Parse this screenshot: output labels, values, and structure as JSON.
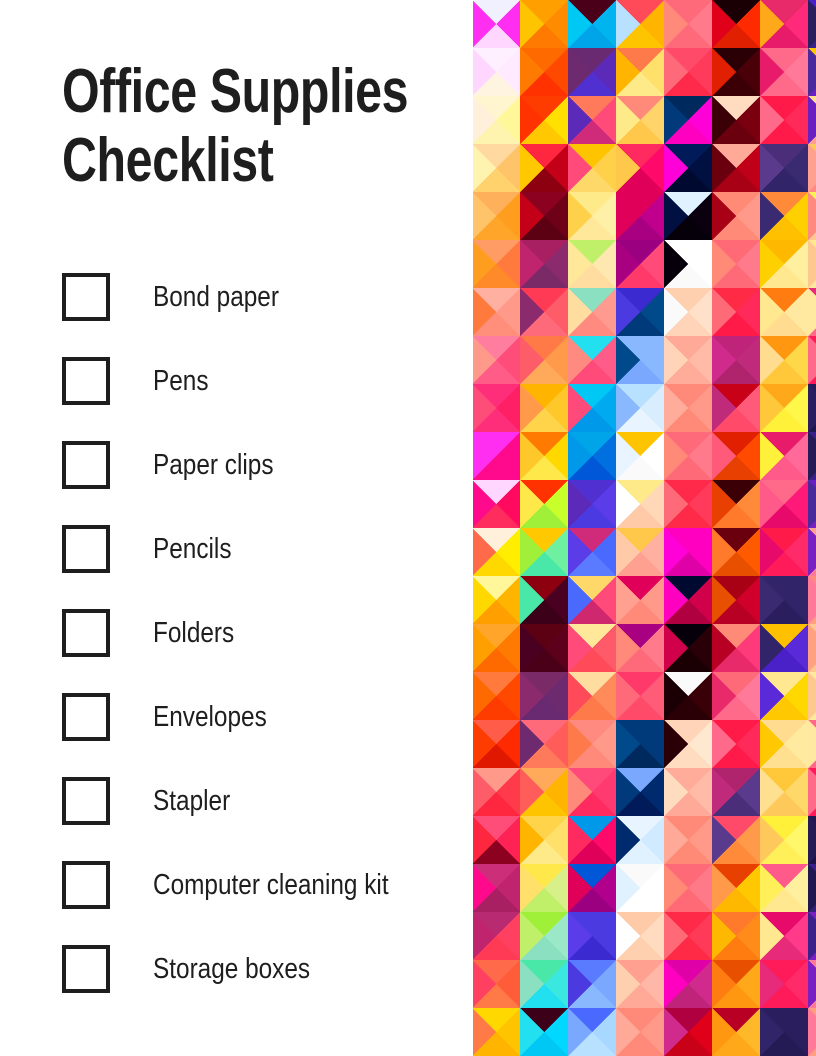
{
  "document": {
    "title_line_1": "Office Supplies",
    "title_line_2": "Checklist"
  },
  "checklist": {
    "items": [
      {
        "label": "Bond paper",
        "checked": false
      },
      {
        "label": "Pens",
        "checked": false
      },
      {
        "label": "Paper clips",
        "checked": false
      },
      {
        "label": "Pencils",
        "checked": false
      },
      {
        "label": "Folders",
        "checked": false
      },
      {
        "label": "Envelopes",
        "checked": false
      },
      {
        "label": "Stapler",
        "checked": false
      },
      {
        "label": "Computer cleaning kit",
        "checked": false
      },
      {
        "label": "Storage boxes",
        "checked": false
      }
    ]
  },
  "theme": {
    "text_color": "#1e1e1e",
    "page_background": "#ffffff",
    "checkbox_border": "#1e1e1e"
  },
  "decoration": {
    "name": "geometric-diamond-pattern",
    "cell": 48,
    "origin_x": -1,
    "origin_y": 0,
    "columns": 8,
    "rows": 22,
    "note": "Each grid cell is a 48x48 square split by both diagonals into 4 triangles: top, right, bottom, left.",
    "grid": [
      [
        "#f0f0ff",
        "#ff2ef0",
        "#ffd6ff",
        "#ff2ef0"
      ],
      [
        "#fff0ff",
        "#ffeaff",
        "#fff4e0",
        "#ffd6ff"
      ],
      [
        "#fff6d0",
        "#fff79a",
        "#fff3b0",
        "#fff0dc"
      ],
      [
        "#ffd9a0",
        "#ffc46a",
        "#ffd26e",
        "#fff3b0"
      ],
      [
        "#ffb05a",
        "#ff9d1e",
        "#ffa52a",
        "#ffc46a"
      ],
      [
        "#ff9c66",
        "#ff7a3c",
        "#ff8a2a",
        "#ff9d1e"
      ],
      [
        "#ffb0a0",
        "#ff9a8a",
        "#ff8f7a",
        "#ff7a3c"
      ],
      [
        "#ff7d9e",
        "#ff4d7a",
        "#ff5c88",
        "#ff9a8a"
      ],
      [
        "#ff2e7a",
        "#ff1f66",
        "#ff2e7a",
        "#ff4d7a"
      ],
      [
        "#ff2ef0",
        "#ff0a8c",
        "#ff0a8c",
        "#ff2ef0"
      ],
      [
        "#ffd6ff",
        "#ff0a5e",
        "#ff2d5e",
        "#ff0a8c"
      ],
      [
        "#fff0dc",
        "#ffee00",
        "#ffd800",
        "#ff6a4a"
      ],
      [
        "#fff79a",
        "#ffb400",
        "#ffa000",
        "#ffd800"
      ],
      [
        "#ffa52a",
        "#ff7a00",
        "#ff6a00",
        "#ffa000"
      ],
      [
        "#ff7a3c",
        "#ff4800",
        "#ff3c00",
        "#ff6a00"
      ],
      [
        "#ff5c4a",
        "#ff2a00",
        "#e01800",
        "#ff3c00"
      ],
      [
        "#ff9a8a",
        "#ff3a4a",
        "#ff2640",
        "#ff5c6a"
      ],
      [
        "#ff4d7a",
        "#ff2355",
        "#8c0020",
        "#ff2640"
      ],
      [
        "#cc2e7a",
        "#c0246e",
        "#a81f62",
        "#ff0a8c"
      ],
      [
        "#b82a72",
        "#ff4060",
        "#ff3a55",
        "#c0246e"
      ],
      [
        "#ff6a4a",
        "#ff5c3a",
        "#ff7a46",
        "#ff4060"
      ],
      [
        "#ffd800",
        "#ffc400",
        "#ffb400",
        "#ff7a46"
      ],
      [
        "#ffa000",
        "#ff8c00",
        "#ff7a00",
        "#ffc400"
      ],
      [
        "#ff6a00",
        "#ff4800",
        "#ff3200",
        "#ff7a00"
      ],
      [
        "#ff3c00",
        "#ffe000",
        "#ffc800",
        "#ff3200"
      ],
      [
        "#ff2640",
        "#c40018",
        "#8c0010",
        "#ffc800"
      ],
      [
        "#8c0020",
        "#6e0018",
        "#5c0014",
        "#c40018"
      ],
      [
        "#a81f62",
        "#8c2a6e",
        "#7a2a66",
        "#c0246e"
      ],
      [
        "#ff3a55",
        "#ff5c6a",
        "#ff6a7a",
        "#8c2a6e"
      ],
      [
        "#ff7a46",
        "#ff9a4a",
        "#ffaa5a",
        "#ff5c6a"
      ],
      [
        "#ffb400",
        "#ffc82a",
        "#ffd44a",
        "#ff9a4a"
      ],
      [
        "#ff7a00",
        "#ffd800",
        "#ffe84a",
        "#ffc82a"
      ],
      [
        "#ff3200",
        "#c8ff2a",
        "#a0f03a",
        "#ffe84a"
      ],
      [
        "#ffc800",
        "#6ef0a0",
        "#4ae8a8",
        "#a0f03a"
      ],
      [
        "#8c0010",
        "#4a0020",
        "#3c0018",
        "#4ae8a8"
      ],
      [
        "#5c0014",
        "#5c001c",
        "#4a0018",
        "#4a0020"
      ],
      [
        "#7a2a66",
        "#6e2a6e",
        "#6a2a72",
        "#8c2a6e"
      ],
      [
        "#ff6a7a",
        "#ff5c5a",
        "#ff7a5a",
        "#6e2a6e"
      ],
      [
        "#ffaa5a",
        "#ffb400",
        "#ffc400",
        "#ff5c5a"
      ],
      [
        "#ffd44a",
        "#ffe06a",
        "#ffea8a",
        "#ffb400"
      ],
      [
        "#ffe84a",
        "#d8f08a",
        "#c0f06a",
        "#ffe06a"
      ],
      [
        "#a0f03a",
        "#9ae8c8",
        "#8ae0c0",
        "#c0f06a"
      ],
      [
        "#4ae8a8",
        "#3ae8e0",
        "#22e0f0",
        "#8ae0c0"
      ],
      [
        "#3c0018",
        "#00d8ff",
        "#00c8f5",
        "#22e0f0"
      ],
      [
        "#4a0018",
        "#00b4f0",
        "#00a4e8",
        "#00c8f5"
      ],
      [
        "#6a2a72",
        "#5c2ab8",
        "#5030d0",
        "#6e2a6e"
      ],
      [
        "#ff7a5a",
        "#ff4a7a",
        "#d02a7a",
        "#5c2ab8"
      ],
      [
        "#ffc400",
        "#ffd04a",
        "#ffd86a",
        "#ff4a7a"
      ],
      [
        "#ffea8a",
        "#fff0a8",
        "#ffe89a",
        "#ffd04a"
      ],
      [
        "#c0f06a",
        "#ffe8b0",
        "#ffdca0",
        "#ffe89a"
      ],
      [
        "#8ae0c0",
        "#ff9a90",
        "#ff8a80",
        "#ffdca0"
      ],
      [
        "#22e0f0",
        "#ff5c8a",
        "#ff4a7a",
        "#ff8a80"
      ],
      [
        "#00c8f5",
        "#00aaf0",
        "#0098e8",
        "#ff4a7a"
      ],
      [
        "#00a4e8",
        "#0070e0",
        "#0058d8",
        "#0098e8"
      ],
      [
        "#5030d0",
        "#5a3ce8",
        "#4a3ae0",
        "#5c2ab8"
      ],
      [
        "#d02a7a",
        "#4a6aff",
        "#5a7aff",
        "#5a3ce8"
      ],
      [
        "#ffd86a",
        "#ff4a7a",
        "#d0286e",
        "#4a6aff"
      ],
      [
        "#ffe89a",
        "#ff5a6a",
        "#ff4a5a",
        "#ff4a7a"
      ],
      [
        "#ffdca0",
        "#ff8a5a",
        "#ff7a4a",
        "#ff4a5a"
      ],
      [
        "#ff8a80",
        "#ff9a8a",
        "#ff8a7a",
        "#ff7a4a"
      ],
      [
        "#ff4a7a",
        "#ff3a70",
        "#ff2a60",
        "#ff8a7a"
      ],
      [
        "#0098e8",
        "#ff0a6a",
        "#e0005a",
        "#ff2a60"
      ],
      [
        "#0058d8",
        "#b0008c",
        "#9a0080",
        "#e0005a"
      ],
      [
        "#4a3ae0",
        "#4a3ae0",
        "#3a2ad0",
        "#5a3ce8"
      ],
      [
        "#5a7aff",
        "#7aa8ff",
        "#8ab8ff",
        "#4a3ae0"
      ],
      [
        "#4a6aff",
        "#a8d8ff",
        "#b8e0ff",
        "#7aa8ff"
      ],
      [
        "#ff4a5a",
        "#ffb400",
        "#ffc400",
        "#b8e0ff"
      ],
      [
        "#ff7a4a",
        "#ffe06a",
        "#ffea8a",
        "#ffb400"
      ],
      [
        "#ff8a7a",
        "#ffd46a",
        "#ffc84a",
        "#ffea8a"
      ],
      [
        "#ff2a60",
        "#ff0a6a",
        "#e0005a",
        "#ffc84a"
      ],
      [
        "#e0005a",
        "#c0008c",
        "#a80080",
        "#e0005a"
      ],
      [
        "#9a0080",
        "#ff4a7a",
        "#ff3a6a",
        "#a80080"
      ],
      [
        "#3a2ad0",
        "#004a8c",
        "#003a7a",
        "#4a3ae0"
      ],
      [
        "#8ab8ff",
        "#8ab8ff",
        "#7aa8ff",
        "#004a8c"
      ],
      [
        "#b8e0ff",
        "#d8eeff",
        "#e8f4ff",
        "#8ab8ff"
      ],
      [
        "#ffc400",
        "#ffffff",
        "#fafafa",
        "#e8f4ff"
      ],
      [
        "#ffea8a",
        "#ffd8b8",
        "#ffcaa8",
        "#ffffff"
      ],
      [
        "#ffc84a",
        "#ffb0a0",
        "#ffa090",
        "#ffcaa8"
      ],
      [
        "#e0005a",
        "#ff9a8a",
        "#ff8a7a",
        "#ffa090"
      ],
      [
        "#a80080",
        "#ff7a8a",
        "#ff6a7a",
        "#ff8a7a"
      ],
      [
        "#ff3a6a",
        "#ff5c7a",
        "#ff4a6a",
        "#ff6a7a"
      ],
      [
        "#003a7a",
        "#003a7a",
        "#002a5e",
        "#004a8c"
      ],
      [
        "#7aa8ff",
        "#002a6e",
        "#001a5a",
        "#003a7a"
      ],
      [
        "#e8f4ff",
        "#d0eaff",
        "#e0f2ff",
        "#002a6e"
      ],
      [
        "#fafafa",
        "#ffffff",
        "#ffffff",
        "#e0f2ff"
      ],
      [
        "#ffcaa8",
        "#ffdcc0",
        "#ffd0b0",
        "#ffffff"
      ],
      [
        "#ffa090",
        "#ffb8a8",
        "#ffaa98",
        "#ffd0b0"
      ],
      [
        "#ff8a7a",
        "#ff9a8a",
        "#ff8a7a",
        "#ffaa98"
      ],
      [
        "#ff6a7a",
        "#ff7a8a",
        "#ff6a7a",
        "#ff8a7a"
      ],
      [
        "#ff4a6a",
        "#ff3a5a",
        "#ff2a4a",
        "#ff6a7a"
      ],
      [
        "#002a5e",
        "#ff00d8",
        "#ff00c0",
        "#003a7a"
      ],
      [
        "#001a5a",
        "#001040",
        "#000a30",
        "#ff00d8"
      ],
      [
        "#e0f2ff",
        "#0a0010",
        "#06000a",
        "#001040"
      ],
      [
        "#ffffff",
        "#ffffff",
        "#fafafa",
        "#06000a"
      ],
      [
        "#ffd0b0",
        "#ffe0c8",
        "#ffd4b8",
        "#fafafa"
      ],
      [
        "#ffaa98",
        "#ffbaa8",
        "#ffac9a",
        "#ffd4b8"
      ],
      [
        "#ff8a7a",
        "#ff9a8a",
        "#ff8a78",
        "#ffac9a"
      ],
      [
        "#ff6a7a",
        "#ff7a8a",
        "#ff6a78",
        "#ff8a78"
      ],
      [
        "#ff2a4a",
        "#ff3a5a",
        "#ff2a48",
        "#ff6a78"
      ],
      [
        "#ff00c0",
        "#ff00c0",
        "#e000a8",
        "#ff00d8"
      ],
      [
        "#000a30",
        "#d0004a",
        "#b00040",
        "#ff00c0"
      ],
      [
        "#06000a",
        "#2a0008",
        "#1a0004",
        "#d0004a"
      ],
      [
        "#fafafa",
        "#3a0008",
        "#2a0006",
        "#1a0004"
      ],
      [
        "#ffd4b8",
        "#ffe8d0",
        "#ffdcc0",
        "#2a0006"
      ],
      [
        "#ffac9a",
        "#ffbaa8",
        "#ffaa98",
        "#ffdcc0"
      ],
      [
        "#ff8a78",
        "#ff9a88",
        "#ff8a76",
        "#ffaa98"
      ],
      [
        "#ff6a78",
        "#ff7a88",
        "#ff6a76",
        "#ff8a76"
      ],
      [
        "#ff2a48",
        "#ff3a58",
        "#ff2a46",
        "#ff6a76"
      ],
      [
        "#e000a8",
        "#d02a8c",
        "#c0247a",
        "#ff00c0"
      ],
      [
        "#b00040",
        "#e0001a",
        "#c80018",
        "#d02a8c"
      ],
      [
        "#1a0004",
        "#ff2a00",
        "#e02000",
        "#e0001a"
      ],
      [
        "#2a0006",
        "#4a0008",
        "#3a0006",
        "#e02000"
      ],
      [
        "#ffdcc0",
        "#7a0010",
        "#6a000e",
        "#3a0006"
      ],
      [
        "#ffaa98",
        "#c00018",
        "#a80014",
        "#6a000e"
      ],
      [
        "#ff8a76",
        "#ff9a8a",
        "#ff8a78",
        "#a80014"
      ],
      [
        "#ff6a76",
        "#ff7a8a",
        "#ff6a78",
        "#ff8a78"
      ],
      [
        "#ff2a46",
        "#ff2a5a",
        "#ff1a48",
        "#ff6a78"
      ],
      [
        "#c0247a",
        "#c02a7a",
        "#b0246e",
        "#d02a8c"
      ],
      [
        "#c80018",
        "#ff5a7a",
        "#ff4a6a",
        "#c02a7a"
      ],
      [
        "#e02000",
        "#ff4a00",
        "#e84000",
        "#ff5a7a"
      ],
      [
        "#3a0006",
        "#ff8a3a",
        "#ff7a2a",
        "#e84000"
      ],
      [
        "#6a000e",
        "#ff5a00",
        "#e85000",
        "#ff7a2a"
      ],
      [
        "#a80014",
        "#d0002a",
        "#b80024",
        "#e85000"
      ],
      [
        "#ff8a78",
        "#ff3a7a",
        "#e82a6a",
        "#b80024"
      ],
      [
        "#ff6a78",
        "#ff7a9a",
        "#ff6a8a",
        "#e82a6a"
      ],
      [
        "#ff1a48",
        "#ff2a5a",
        "#ff1a4a",
        "#ff6a8a"
      ],
      [
        "#b0246e",
        "#5a3a8c",
        "#4a2e7a",
        "#c02a7a"
      ],
      [
        "#ff4a6a",
        "#ff9a4a",
        "#ff8a3a",
        "#5a3a8c"
      ],
      [
        "#e84000",
        "#ffc800",
        "#ffb800",
        "#ff9a4a"
      ],
      [
        "#ff7a2a",
        "#ff8c1a",
        "#ff7c10",
        "#ffb800"
      ],
      [
        "#e85000",
        "#ffa81a",
        "#ff9810",
        "#ff7c10"
      ],
      [
        "#b80024",
        "#ffb82a",
        "#ffa81a",
        "#ff9810"
      ],
      [
        "#e82a6a",
        "#ff2a7a",
        "#e81a6a",
        "#ffa81a"
      ],
      [
        "#ff6a8a",
        "#ff7a9a",
        "#ff6a8a",
        "#e81a6a"
      ],
      [
        "#ff1a4a",
        "#ff2a5a",
        "#ff1a4a",
        "#ff6a8a"
      ],
      [
        "#4a2e7a",
        "#3a2a72",
        "#322468",
        "#5a3a8c"
      ],
      [
        "#ff8a3a",
        "#ffd000",
        "#ffc000",
        "#3a2a72"
      ],
      [
        "#ffb800",
        "#fff0a0",
        "#ffe890",
        "#ffd000"
      ],
      [
        "#ff7c10",
        "#ffe8a0",
        "#ffdc90",
        "#ffe890"
      ],
      [
        "#ff9810",
        "#ffd84a",
        "#ffc83a",
        "#ffdc90"
      ],
      [
        "#ffa81a",
        "#fff84a",
        "#fff03a",
        "#ffc83a"
      ],
      [
        "#e81a6a",
        "#ff6a9a",
        "#ff5a8a",
        "#fff03a"
      ],
      [
        "#ff6a8a",
        "#ff1a7a",
        "#e80a6a",
        "#ff5a8a"
      ],
      [
        "#ff1a4a",
        "#ff2a6a",
        "#ff1a5a",
        "#e80a6a"
      ],
      [
        "#322468",
        "#322468",
        "#2a1e5e",
        "#3a2a72"
      ],
      [
        "#ffc000",
        "#5a2ad8",
        "#4a20c8",
        "#322468"
      ],
      [
        "#ffe890",
        "#ffd800",
        "#ffc800",
        "#5a2ad8"
      ],
      [
        "#ffdc90",
        "#ffeaa0",
        "#ffe090",
        "#ffc800"
      ],
      [
        "#ffc83a",
        "#ffd86a",
        "#ffc85a",
        "#ffe090"
      ],
      [
        "#fff03a",
        "#fff86a",
        "#fff05a",
        "#ffc85a"
      ],
      [
        "#ff5a8a",
        "#fff0a0",
        "#ffe890",
        "#fff05a"
      ],
      [
        "#e80a6a",
        "#ff3a8a",
        "#e82a7a",
        "#ffe890"
      ],
      [
        "#ff1a5a",
        "#ff2a6a",
        "#ff1a5a",
        "#e82a7a"
      ],
      [
        "#2a1e5e",
        "#2a1e5e",
        "#241a54",
        "#322468"
      ],
      [
        "#4a20c8",
        "#4a2a9a",
        "#3a2088",
        "#2a1e5e"
      ],
      [
        "#ffc800",
        "#7a2ad0",
        "#6a20c0",
        "#4a2a9a"
      ],
      [
        "#ffe090",
        "#ffb0a0",
        "#ffa090",
        "#6a20c0"
      ],
      [
        "#ffc85a",
        "#ff9a90",
        "#ff8a80",
        "#ffa090"
      ],
      [
        "#fff05a",
        "#ffd8a0",
        "#ffc890",
        "#ff8a80"
      ],
      [
        "#ffe890",
        "#fff0b0",
        "#ffe8a0",
        "#ffc890"
      ],
      [
        "#e82a7a",
        "#ff7a9a",
        "#ff6a8a",
        "#ffe8a0"
      ],
      [
        "#ff1a5a",
        "#ff2a6a",
        "#ff1a5a",
        "#ff6a8a"
      ],
      [
        "#241a54",
        "#241a54",
        "#201650",
        "#2a1e5e"
      ],
      [
        "#3a2088",
        "#4a2a9a",
        "#3a2088",
        "#241a54"
      ],
      [
        "#6a20c0",
        "#8a2ad0",
        "#7a20c0",
        "#4a2a9a"
      ],
      [
        "#ffa090",
        "#ff8aa8",
        "#ff7a98",
        "#7a20c0"
      ],
      [
        "#ff8a80",
        "#ffb090",
        "#ffa080",
        "#ff7a98"
      ],
      [
        "#ffc890",
        "#ffd8a0",
        "#ffc890",
        "#ffa080"
      ],
      [
        "#ffe8a0",
        "#fff0b0",
        "#ffe8a0",
        "#ffc890"
      ],
      [
        "#ff6a8a",
        "#ff7a9a",
        "#ff6a8a",
        "#ffe8a0"
      ],
      [
        "#ff1a5a",
        "#ff2a6a",
        "#ff1a5a",
        "#ff6a8a"
      ],
      [
        "#201650",
        "#201650",
        "#1c1248",
        "#241a54"
      ],
      [
        "#3a2088",
        "#3a2088",
        "#322078",
        "#201650"
      ],
      [
        "#7a20c0",
        "#8a2ad0",
        "#7a20c0",
        "#3a2088"
      ],
      [
        "#ff7a98",
        "#ff8aa8",
        "#ff7a98",
        "#7a20c0"
      ],
      [
        "#ffa080",
        "#ffb090",
        "#ffa080",
        "#ff7a98"
      ],
      [
        "#ffc890",
        "#ffd8a0",
        "#ffc890",
        "#ffa080"
      ],
      [
        "#ffe8a0",
        "#fff0b0",
        "#ffe8a0",
        "#ffc890"
      ],
      [
        "#ff6a8a",
        "#ff7a9a",
        "#ff6a8a",
        "#ffe8a0"
      ],
      [
        "#ff1a5a",
        "#ff2a6a",
        "#ff1a5a",
        "#ff6a8a"
      ]
    ]
  }
}
